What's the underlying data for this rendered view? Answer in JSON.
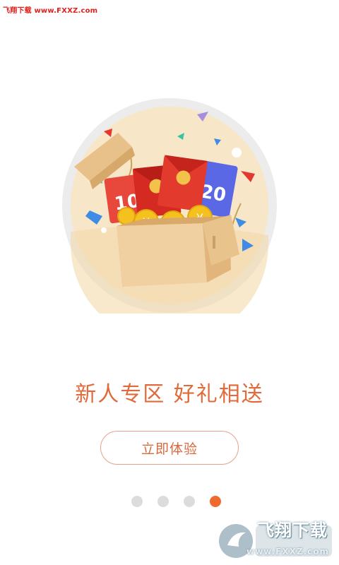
{
  "watermark_top": "飞翔下载 www.FXXZ.com",
  "headline": "新人专区   好礼相送",
  "cta_label": "立即体验",
  "pager": {
    "count": 4,
    "active_index": 3,
    "active_color": "#ee6a2e",
    "inactive_color": "#dcdcdc"
  },
  "illustration": {
    "icon": "gift-box-with-coupons-icon",
    "coupon_left": "10",
    "coupon_right": "20",
    "coin_symbol": "¥"
  },
  "watermark_bottom": {
    "title": "飞翔下载",
    "url": "www.FXXZ.com"
  },
  "colors": {
    "accent": "#e06a3a",
    "button_border": "#e7a18a"
  }
}
